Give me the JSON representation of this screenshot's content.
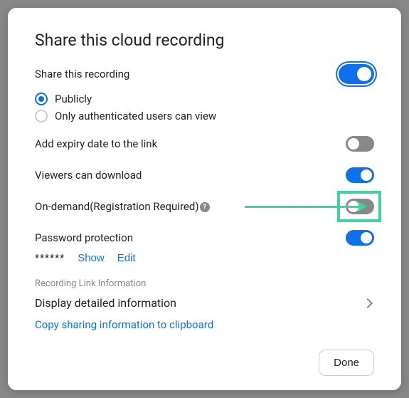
{
  "title": "Share this cloud recording",
  "share": {
    "label": "Share this recording",
    "enabled": true,
    "options": {
      "publicly": "Publicly",
      "authenticated": "Only authenticated users can view"
    },
    "selected": "publicly"
  },
  "expiry": {
    "label": "Add expiry date to the link",
    "enabled": false
  },
  "download": {
    "label": "Viewers can download",
    "enabled": true
  },
  "ondemand": {
    "label": "On-demand(Registration Required)",
    "enabled": false,
    "help": "?"
  },
  "password": {
    "label": "Password protection",
    "enabled": true,
    "mask": "******",
    "show": "Show",
    "edit": "Edit"
  },
  "linkinfo": {
    "header": "Recording Link Information",
    "detail": "Display detailed information",
    "copy": "Copy sharing information to clipboard"
  },
  "footer": {
    "done": "Done"
  }
}
